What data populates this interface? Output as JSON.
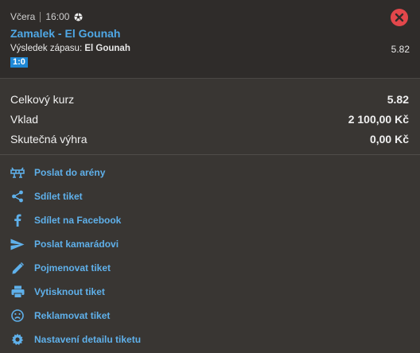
{
  "ticket": {
    "day": "Včera",
    "time": "16:00",
    "sport_icon": "soccer-ball-icon",
    "match": "Zamalek - El Gounah",
    "market_label": "Výsledek zápasu:",
    "pick": "El Gounah",
    "odd": "5.82",
    "score": "1:0",
    "status_color": "#e2474b"
  },
  "summary": {
    "total_odds_label": "Celkový kurz",
    "total_odds_value": "5.82",
    "stake_label": "Vklad",
    "stake_value": "2 100,00 Kč",
    "win_label": "Skutečná výhra",
    "win_value": "0,00 Kč"
  },
  "actions": [
    {
      "label": "Poslat do arény",
      "icon": "arena-icon"
    },
    {
      "label": "Sdílet tiket",
      "icon": "share-icon"
    },
    {
      "label": "Sdílet na Facebook",
      "icon": "facebook-icon"
    },
    {
      "label": "Poslat kamarádovi",
      "icon": "send-icon"
    },
    {
      "label": "Pojmenovat tiket",
      "icon": "pencil-icon"
    },
    {
      "label": "Vytisknout tiket",
      "icon": "printer-icon"
    },
    {
      "label": "Reklamovat tiket",
      "icon": "sad-face-icon"
    },
    {
      "label": "Nastavení detailu tiketu",
      "icon": "gear-icon"
    }
  ],
  "colors": {
    "link": "#5fb0ea",
    "accent": "#1e88d6"
  }
}
